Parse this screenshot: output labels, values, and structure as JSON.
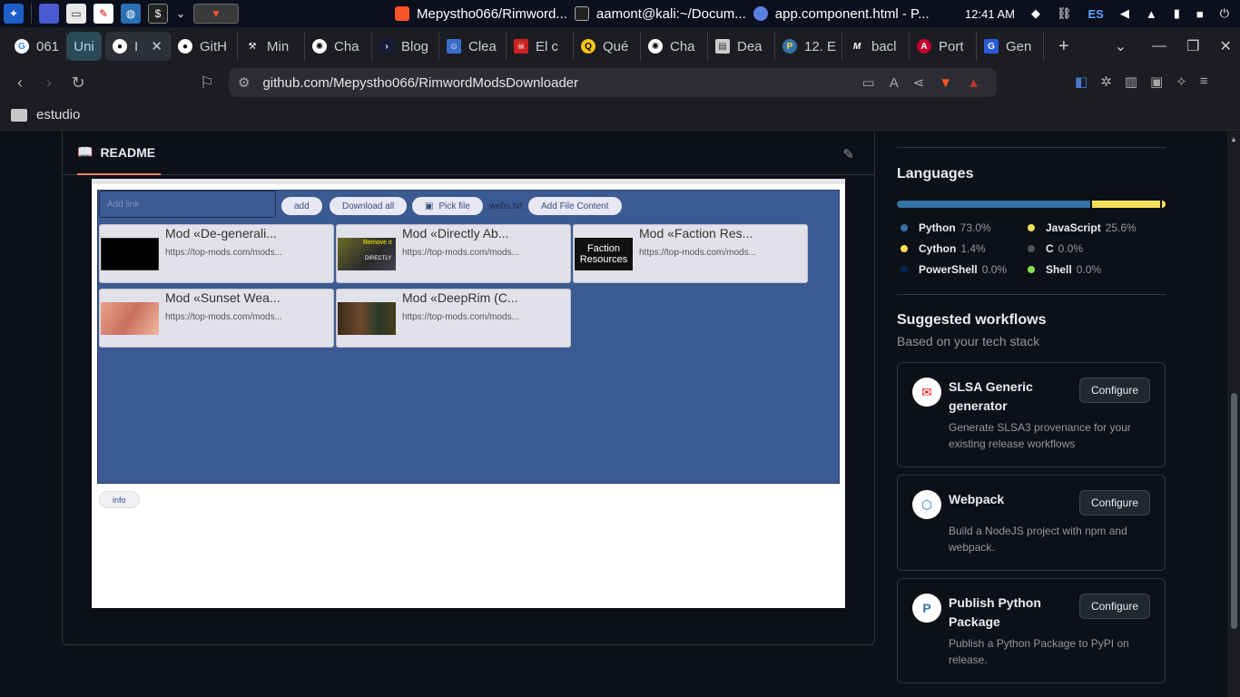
{
  "taskbar": {
    "windows": [
      {
        "title": "Mepystho066/Rimword...",
        "icon": "brave-icon"
      },
      {
        "title": "aamont@kali:~/Docum...",
        "icon": "terminal-icon"
      },
      {
        "title": "app.component.html - P...",
        "icon": "app-icon"
      }
    ],
    "clock": "12:41 AM",
    "keyboard_layout": "ES"
  },
  "tabs": [
    {
      "label": "061",
      "icon": "google-icon"
    },
    {
      "label": "Uni",
      "icon": "uni-icon"
    },
    {
      "label": "I",
      "icon": "github-icon"
    },
    {
      "label": "GitH",
      "icon": "github-icon"
    },
    {
      "label": "Min",
      "icon": "tool-icon"
    },
    {
      "label": "Cha",
      "icon": "chatgpt-icon"
    },
    {
      "label": "Blog",
      "icon": "blog-icon"
    },
    {
      "label": "Clea",
      "icon": "clean-icon"
    },
    {
      "label": "El c",
      "icon": "news-icon"
    },
    {
      "label": "Qué",
      "icon": "que-icon"
    },
    {
      "label": "Cha",
      "icon": "chatgpt-icon"
    },
    {
      "label": "Dea",
      "icon": "doc-icon"
    },
    {
      "label": "12. E",
      "icon": "python-icon"
    },
    {
      "label": "bacl",
      "icon": "medium-icon"
    },
    {
      "label": "Port",
      "icon": "angular-icon"
    },
    {
      "label": "Gen",
      "icon": "gen-icon"
    }
  ],
  "address": {
    "url": "github.com/Mepystho066/RimwordModsDownloader"
  },
  "bookmarks": [
    {
      "label": "estudio"
    }
  ],
  "readme": {
    "tab_label": "README",
    "app": {
      "input_placeholder": "Add link",
      "add_button": "add",
      "download_all_button": "Download all",
      "pick_file_button": "Pick file",
      "file_name": "webs.txt",
      "add_file_content_button": "Add File Content",
      "info_button": "info",
      "cards": [
        {
          "title": "Mod «De-generali...",
          "url": "https://top-mods.com/mods..."
        },
        {
          "title": "Mod «Directly Ab...",
          "url": "https://top-mods.com/mods..."
        },
        {
          "title": "Mod «Faction Res...",
          "url": "https://top-mods.com/mods..."
        },
        {
          "title": "Mod «Sunset Wea...",
          "url": "https://top-mods.com/mods..."
        },
        {
          "title": "Mod «DeepRim (C...",
          "url": "https://top-mods.com/mods..."
        }
      ],
      "thumb_text": {
        "faction_line1": "Faction",
        "faction_line2": "Resources",
        "remove_it": "Remove it",
        "directly": "DIRECTLY"
      }
    }
  },
  "sidebar": {
    "languages_title": "Languages",
    "languages": [
      {
        "name": "Python",
        "percent": "73.0%",
        "value": 73.0,
        "color": "#3572A5"
      },
      {
        "name": "JavaScript",
        "percent": "25.6%",
        "value": 25.6,
        "color": "#f1e05a"
      },
      {
        "name": "Cython",
        "percent": "1.4%",
        "value": 1.4,
        "color": "#fedf5b"
      },
      {
        "name": "C",
        "percent": "0.0%",
        "value": 0.0,
        "color": "#555555"
      },
      {
        "name": "PowerShell",
        "percent": "0.0%",
        "value": 0.0,
        "color": "#012456"
      },
      {
        "name": "Shell",
        "percent": "0.0%",
        "value": 0.0,
        "color": "#89e051"
      }
    ],
    "workflows_title": "Suggested workflows",
    "workflows_subtitle": "Based on your tech stack",
    "workflows": [
      {
        "title": "SLSA Generic generator",
        "button": "Configure",
        "description": "Generate SLSA3 provenance for your existing release workflows"
      },
      {
        "title": "Webpack",
        "button": "Configure",
        "description": "Build a NodeJS project with npm and webpack."
      },
      {
        "title": "Publish Python Package",
        "button": "Configure",
        "description": "Publish a Python Package to PyPI on release."
      }
    ]
  }
}
